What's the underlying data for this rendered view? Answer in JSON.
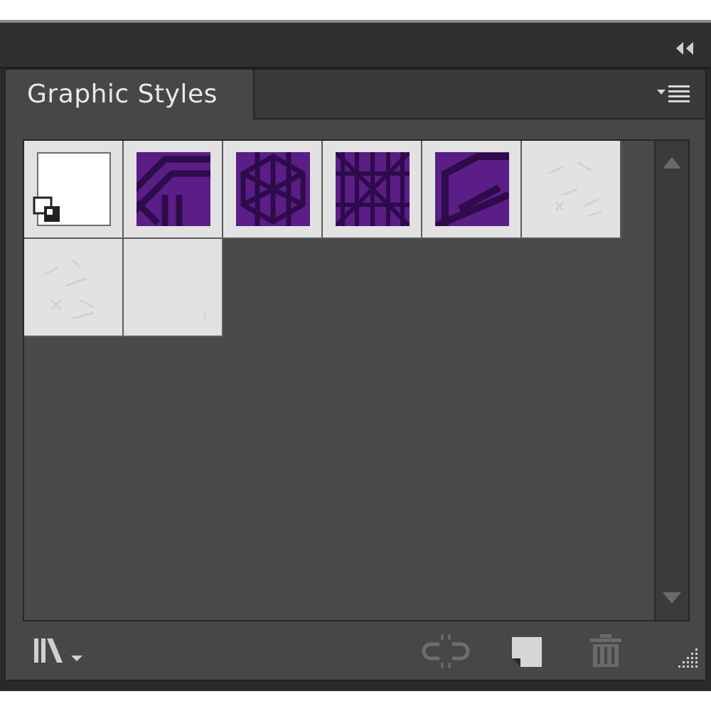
{
  "panel": {
    "tab_label": "Graphic Styles"
  },
  "icons": {
    "collapse": "double-chevron-left-icon",
    "panel_menu": "panel-menu-icon",
    "libraries": "graphic-styles-libraries-icon",
    "break_link": "break-link-icon",
    "new_style": "new-graphic-style-icon",
    "delete": "delete-trash-icon",
    "resize": "resize-grip-icon"
  },
  "swatches": [
    {
      "kind": "default",
      "color": "#ffffff"
    },
    {
      "kind": "pattern",
      "color": "#5b1d86"
    },
    {
      "kind": "pattern",
      "color": "#5b1d86"
    },
    {
      "kind": "pattern",
      "color": "#5b1d86"
    },
    {
      "kind": "pattern",
      "color": "#5b1d86"
    },
    {
      "kind": "faded",
      "color": "#e2e2e2"
    },
    {
      "kind": "faded",
      "color": "#e2e2e2"
    },
    {
      "kind": "blank",
      "color": "#e2e2e2"
    }
  ],
  "colors": {
    "purple": "#5b1d86",
    "purple_dark": "#2e0b4a",
    "panel_bg": "#474747",
    "swatch_bg": "#e2e2e2"
  }
}
